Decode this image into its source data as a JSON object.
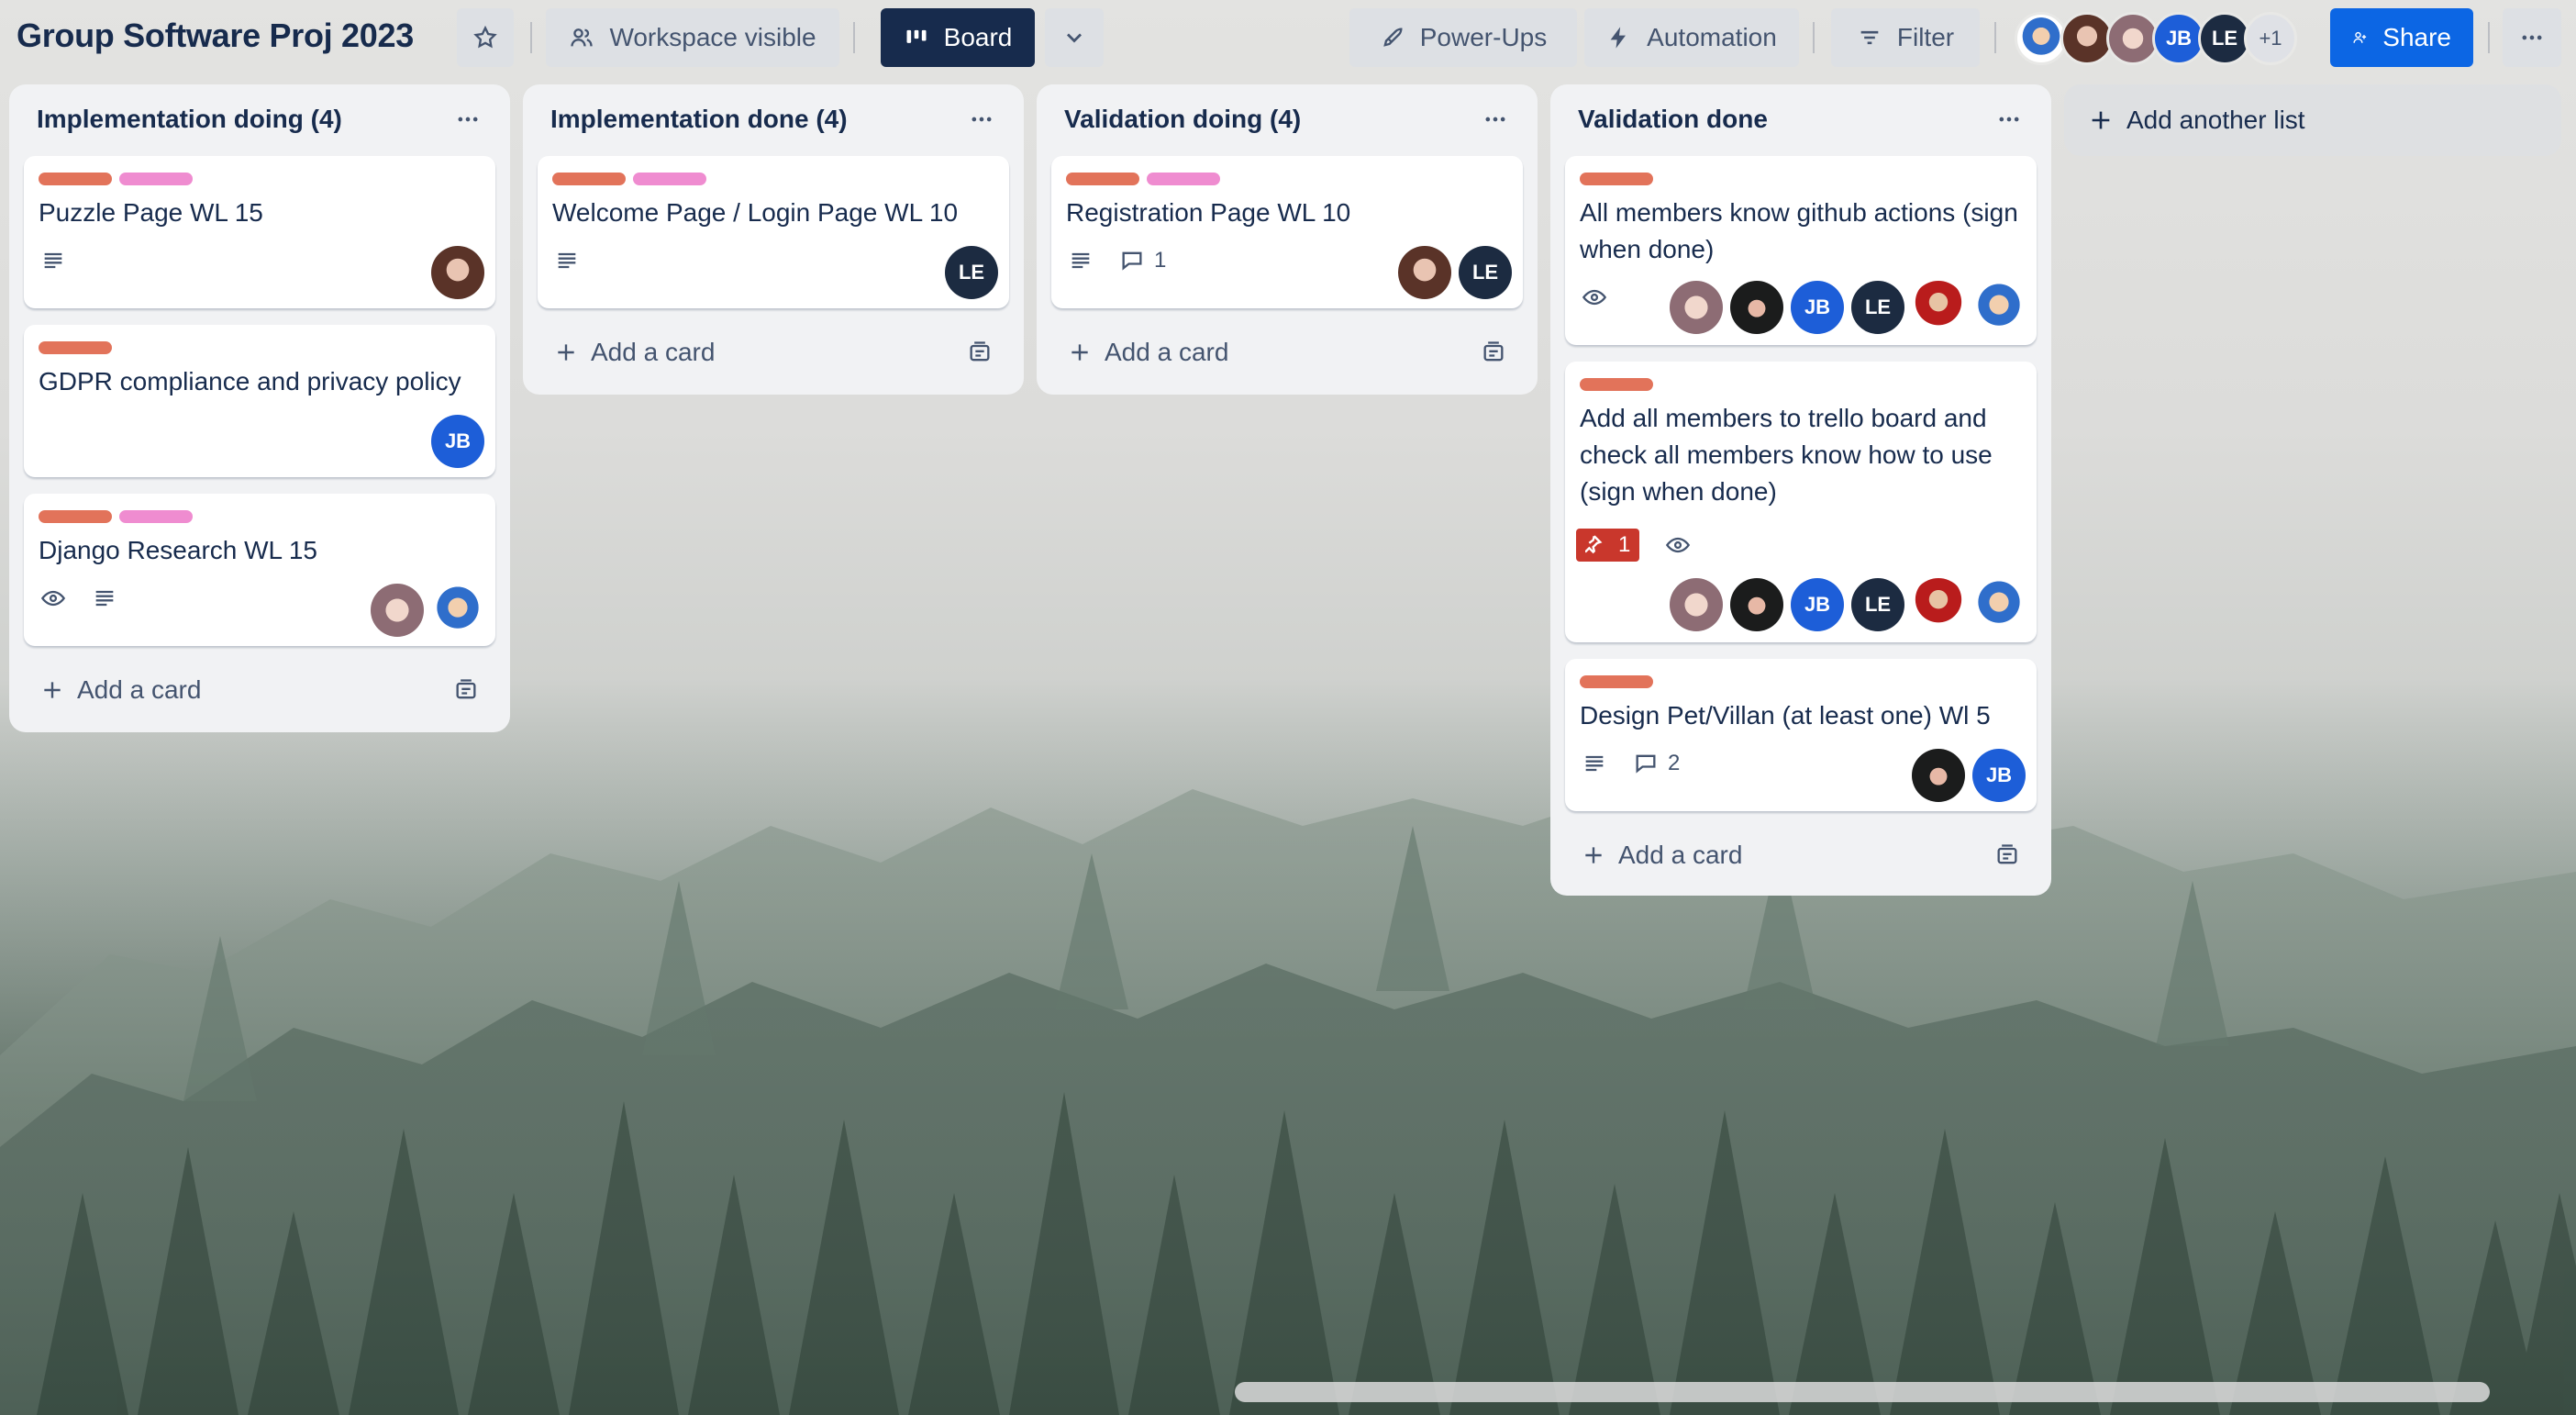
{
  "board": {
    "title": "Group Software Proj 2023",
    "visibility_label": "Workspace visible",
    "view_label": "Board",
    "powerups_label": "Power-Ups",
    "automation_label": "Automation",
    "filter_label": "Filter",
    "share_label": "Share",
    "members_more": "+1"
  },
  "lists": [
    {
      "title": "Implementation doing (4)",
      "add_card_label": "Add a card",
      "cards": [
        {
          "title": "Puzzle Page WL 15",
          "labels": [
            "red",
            "pink"
          ]
        },
        {
          "title": "GDPR compliance and privacy policy",
          "labels": [
            "red"
          ],
          "members": [
            "JB"
          ]
        },
        {
          "title": "Django Research WL 15",
          "labels": [
            "red",
            "pink"
          ]
        }
      ]
    },
    {
      "title": "Implementation done (4)",
      "add_card_label": "Add a card",
      "cards": [
        {
          "title": "Welcome Page / Login Page WL 10",
          "labels": [
            "red",
            "pink"
          ],
          "members": [
            "LE"
          ]
        }
      ]
    },
    {
      "title": "Validation doing (4)",
      "add_card_label": "Add a card",
      "cards": [
        {
          "title": "Registration Page WL 10",
          "labels": [
            "red",
            "pink"
          ],
          "comments": "1",
          "members": [
            "LE"
          ]
        }
      ]
    },
    {
      "title": "Validation done",
      "add_card_label": "Add a card",
      "cards": [
        {
          "title": "All members know github actions (sign when done)",
          "labels": [
            "red"
          ],
          "members": [
            "JB",
            "LE"
          ]
        },
        {
          "title": "Add all members to trello board and check all members know how to use (sign when done)",
          "labels": [
            "red"
          ],
          "attachments": "1",
          "members": [
            "JB",
            "LE"
          ]
        },
        {
          "title": "Design Pet/Villan (at least one) Wl 5",
          "labels": [
            "red"
          ],
          "comments": "2",
          "members": [
            "JB"
          ]
        }
      ]
    }
  ],
  "add_list_label": "Add another list",
  "colors": {
    "label_red": "#e2735a",
    "label_pink": "#ef8cd0",
    "board_button": "#172b4d",
    "share_button": "#0c66e4",
    "member_jb": "#1d5ed8",
    "member_le": "#1c2b41"
  },
  "icons": {
    "star": "star-icon",
    "visibility": "people-icon",
    "board": "board-icon",
    "powerups": "rocket-icon",
    "automation": "lightning-icon",
    "filter": "filter-icon",
    "share": "add-person-icon",
    "more": "ellipsis-icon",
    "description": "description-icon",
    "comment": "comment-icon",
    "watch": "eye-icon",
    "attachment": "pin-icon",
    "template": "template-icon",
    "plus": "plus-icon"
  }
}
